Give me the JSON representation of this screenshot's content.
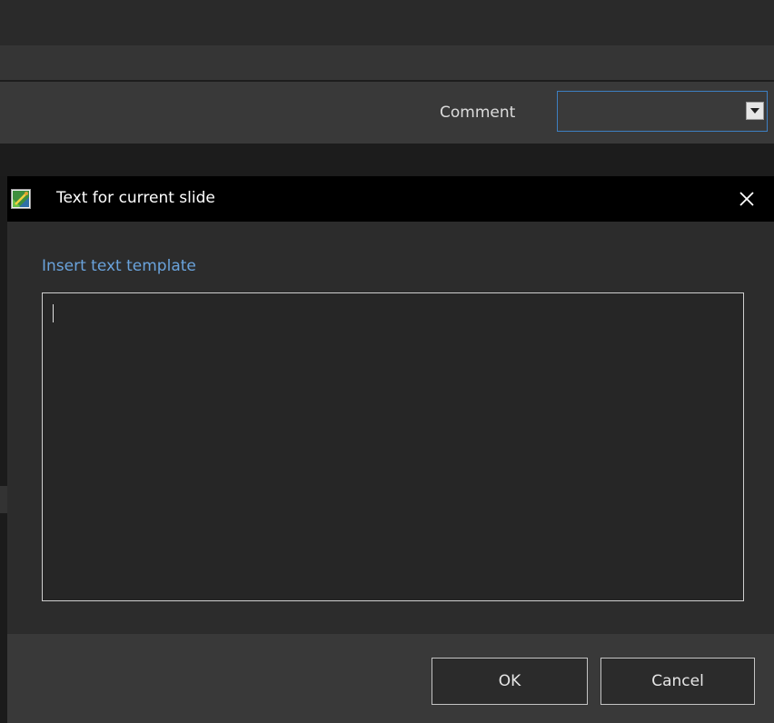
{
  "comment_bar": {
    "label": "Comment",
    "combo_value": ""
  },
  "dialog": {
    "title": "Text for current slide",
    "insert_template_link": "Insert text template",
    "text_value": "",
    "ok_label": "OK",
    "cancel_label": "Cancel"
  },
  "colors": {
    "accent_link": "#6aa3dc",
    "focus_border": "#3d7fc1",
    "titlebar": "#000000"
  },
  "icons": {
    "app": "slide-image-icon",
    "close": "close-icon",
    "combo": "chevron-down-icon"
  }
}
